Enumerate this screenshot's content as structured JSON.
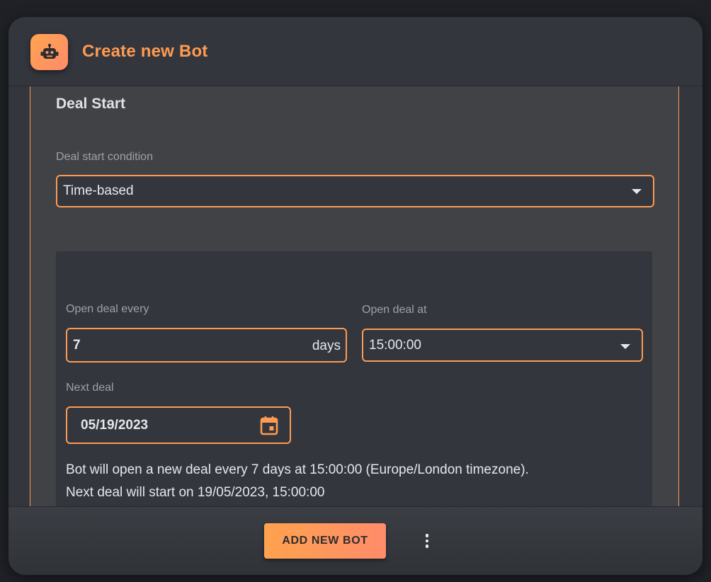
{
  "header": {
    "title": "Create new Bot",
    "avatar_icon": "robot-icon"
  },
  "deal_start": {
    "section_title": "Deal Start",
    "condition": {
      "label": "Deal start condition",
      "value": "Time-based"
    },
    "open_every": {
      "label": "Open deal every",
      "value": "7",
      "suffix": "days"
    },
    "open_at": {
      "label": "Open deal at",
      "value": "15:00:00"
    },
    "next_deal": {
      "label": "Next deal",
      "value": "05/19/2023",
      "icon": "calendar-icon"
    },
    "summary": "Bot will open a new deal every 7 days at 15:00:00 (Europe/London timezone). Next deal will start on 19/05/2023, 15:00:00"
  },
  "footer": {
    "add_button_label": "ADD NEW BOT",
    "more_icon": "more-vertical-icon"
  },
  "colors": {
    "accent": "#ff9a52",
    "panel": "#33363d",
    "card": "#404246",
    "text": "#e6e7ea",
    "label": "#9ea1a7"
  }
}
